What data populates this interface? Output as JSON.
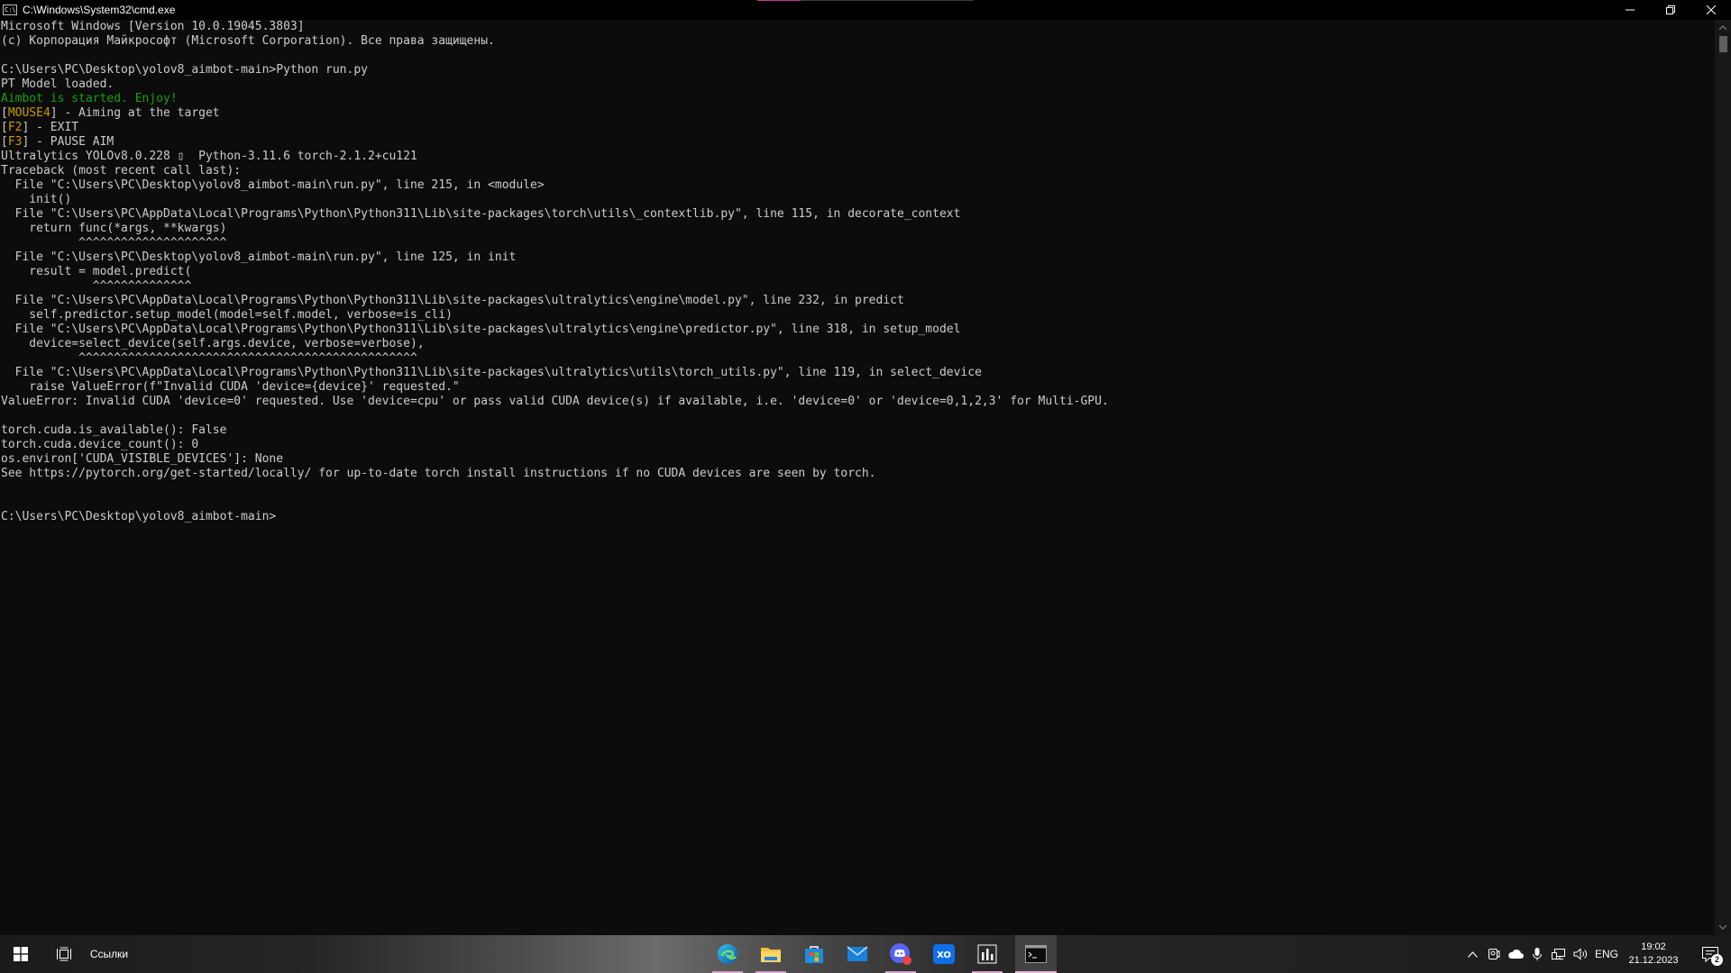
{
  "window": {
    "title": "C:\\Windows\\System32\\cmd.exe",
    "icon": "cmd-icon"
  },
  "console": {
    "lines": [
      [
        {
          "text": "Microsoft Windows [Version 10.0.19045.3803]",
          "color": "default"
        }
      ],
      [
        {
          "text": "(c) Корпорация Майкрософт (Microsoft Corporation). Все права защищены.",
          "color": "default"
        }
      ],
      [
        {
          "text": "",
          "color": "default"
        }
      ],
      [
        {
          "text": "C:\\Users\\PC\\Desktop\\yolov8_aimbot-main>Python run.py",
          "color": "default"
        }
      ],
      [
        {
          "text": "PT Model loaded.",
          "color": "default"
        }
      ],
      [
        {
          "text": "Aimbot is started. Enjoy!",
          "color": "green"
        }
      ],
      [
        {
          "text": "[",
          "color": "default"
        },
        {
          "text": "MOUSE4",
          "color": "yellow"
        },
        {
          "text": "] - Aiming at the target",
          "color": "default"
        }
      ],
      [
        {
          "text": "[",
          "color": "default"
        },
        {
          "text": "F2",
          "color": "yellow"
        },
        {
          "text": "] - EXIT",
          "color": "default"
        }
      ],
      [
        {
          "text": "[",
          "color": "default"
        },
        {
          "text": "F3",
          "color": "yellow"
        },
        {
          "text": "] - PAUSE AIM",
          "color": "default"
        }
      ],
      [
        {
          "text": "Ultralytics YOLOv8.0.228 ▯  Python-3.11.6 torch-2.1.2+cu121",
          "color": "default"
        }
      ],
      [
        {
          "text": "Traceback (most recent call last):",
          "color": "default"
        }
      ],
      [
        {
          "text": "  File \"C:\\Users\\PC\\Desktop\\yolov8_aimbot-main\\run.py\", line 215, in <module>",
          "color": "default"
        }
      ],
      [
        {
          "text": "    init()",
          "color": "default"
        }
      ],
      [
        {
          "text": "  File \"C:\\Users\\PC\\AppData\\Local\\Programs\\Python\\Python311\\Lib\\site-packages\\torch\\utils\\_contextlib.py\", line 115, in decorate_context",
          "color": "default"
        }
      ],
      [
        {
          "text": "    return func(*args, **kwargs)",
          "color": "default"
        }
      ],
      [
        {
          "text": "           ^^^^^^^^^^^^^^^^^^^^^",
          "color": "default"
        }
      ],
      [
        {
          "text": "  File \"C:\\Users\\PC\\Desktop\\yolov8_aimbot-main\\run.py\", line 125, in init",
          "color": "default"
        }
      ],
      [
        {
          "text": "    result = model.predict(",
          "color": "default"
        }
      ],
      [
        {
          "text": "             ^^^^^^^^^^^^^^",
          "color": "default"
        }
      ],
      [
        {
          "text": "  File \"C:\\Users\\PC\\AppData\\Local\\Programs\\Python\\Python311\\Lib\\site-packages\\ultralytics\\engine\\model.py\", line 232, in predict",
          "color": "default"
        }
      ],
      [
        {
          "text": "    self.predictor.setup_model(model=self.model, verbose=is_cli)",
          "color": "default"
        }
      ],
      [
        {
          "text": "  File \"C:\\Users\\PC\\AppData\\Local\\Programs\\Python\\Python311\\Lib\\site-packages\\ultralytics\\engine\\predictor.py\", line 318, in setup_model",
          "color": "default"
        }
      ],
      [
        {
          "text": "    device=select_device(self.args.device, verbose=verbose),",
          "color": "default"
        }
      ],
      [
        {
          "text": "           ^^^^^^^^^^^^^^^^^^^^^^^^^^^^^^^^^^^^^^^^^^^^^^^^",
          "color": "default"
        }
      ],
      [
        {
          "text": "  File \"C:\\Users\\PC\\AppData\\Local\\Programs\\Python\\Python311\\Lib\\site-packages\\ultralytics\\utils\\torch_utils.py\", line 119, in select_device",
          "color": "default"
        }
      ],
      [
        {
          "text": "    raise ValueError(f\"Invalid CUDA 'device={device}' requested.\"",
          "color": "default"
        }
      ],
      [
        {
          "text": "ValueError: Invalid CUDA 'device=0' requested. Use 'device=cpu' or pass valid CUDA device(s) if available, i.e. 'device=0' or 'device=0,1,2,3' for Multi-GPU.",
          "color": "default"
        }
      ],
      [
        {
          "text": "",
          "color": "default"
        }
      ],
      [
        {
          "text": "torch.cuda.is_available(): False",
          "color": "default"
        }
      ],
      [
        {
          "text": "torch.cuda.device_count(): 0",
          "color": "default"
        }
      ],
      [
        {
          "text": "os.environ['CUDA_VISIBLE_DEVICES']: None",
          "color": "default"
        }
      ],
      [
        {
          "text": "See https://pytorch.org/get-started/locally/ for up-to-date torch install instructions if no CUDA devices are seen by torch.",
          "color": "default"
        }
      ],
      [
        {
          "text": "",
          "color": "default"
        }
      ],
      [
        {
          "text": "",
          "color": "default"
        }
      ],
      [
        {
          "text": "C:\\Users\\PC\\Desktop\\yolov8_aimbot-main>",
          "color": "default"
        }
      ]
    ]
  },
  "colors": {
    "console_bg": "#0c0c0c",
    "console_text": "#cccccc",
    "yellow": "#c19c00",
    "green": "#13a10e",
    "taskbar_accent": "#f0b6dd"
  },
  "taskbar": {
    "links_label": "Ссылки",
    "pinned": [
      {
        "name": "edge-icon",
        "active": false,
        "running": true
      },
      {
        "name": "file-explorer-icon",
        "active": false,
        "running": true
      },
      {
        "name": "microsoft-store-icon",
        "active": false,
        "running": false
      },
      {
        "name": "mail-icon",
        "active": false,
        "running": false
      },
      {
        "name": "discord-icon",
        "active": false,
        "running": true
      },
      {
        "name": "xbox-icon",
        "active": false,
        "running": false
      },
      {
        "name": "task-manager-icon",
        "active": false,
        "running": true
      },
      {
        "name": "command-prompt-icon",
        "active": true,
        "running": true
      }
    ],
    "tray": {
      "language": "ENG",
      "time": "19:02",
      "date": "21.12.2023",
      "notifications": "2"
    }
  }
}
